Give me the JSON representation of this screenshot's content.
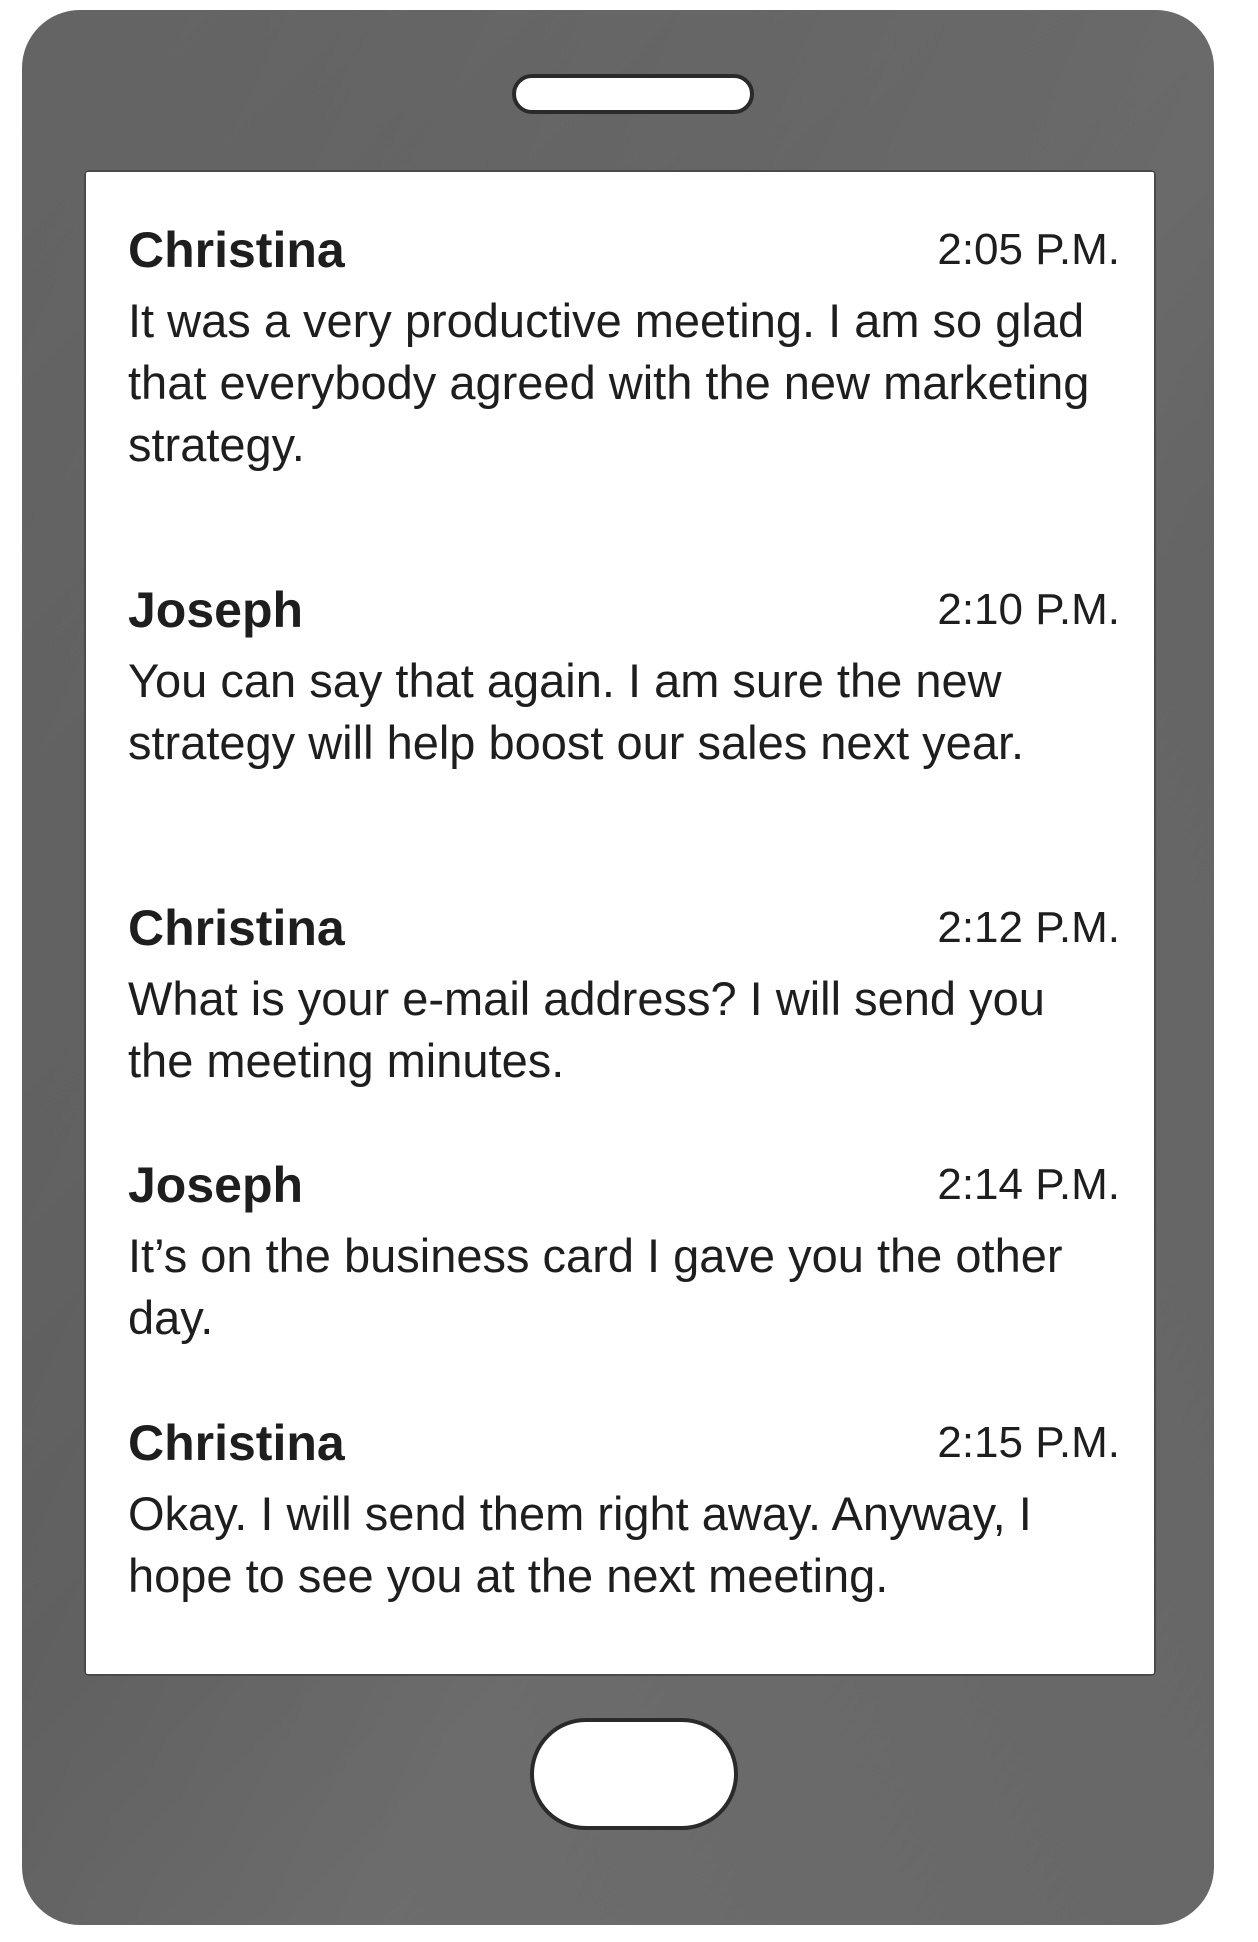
{
  "colors": {
    "phone_body": "#626262",
    "screen": "#ffffff",
    "text": "#1e1e1e"
  },
  "messages": [
    {
      "sender": "Christina",
      "time": "2:05 P.M.",
      "text": "It was a very productive meeting. I am so glad that everybody agreed with the new marketing strategy."
    },
    {
      "sender": "Joseph",
      "time": "2:10 P.M.",
      "text": "You can say that again. I am sure the new strategy will help boost our sales next year."
    },
    {
      "sender": "Christina",
      "time": "2:12 P.M.",
      "text": "What is your e-mail address? I will send you the meeting minutes."
    },
    {
      "sender": "Joseph",
      "time": "2:14 P.M.",
      "text": "It’s on the business card I gave you the other day."
    },
    {
      "sender": "Christina",
      "time": "2:15 P.M.",
      "text": "Okay. I will send them right away. Anyway, I hope to see you at the next meeting."
    }
  ]
}
